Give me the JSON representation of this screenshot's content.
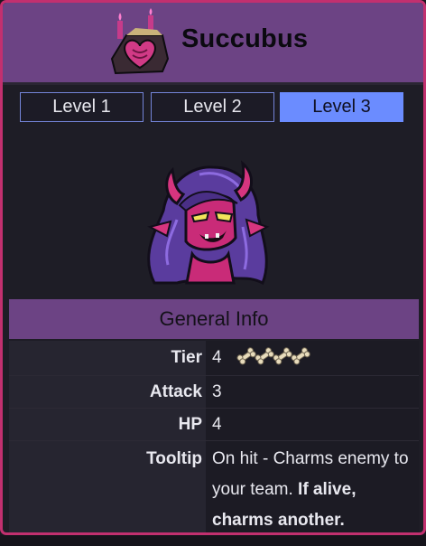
{
  "header": {
    "title": "Succubus",
    "icon": "succubus-emblem-icon"
  },
  "tabs": [
    {
      "label": "Level 1",
      "active": false
    },
    {
      "label": "Level 2",
      "active": false
    },
    {
      "label": "Level 3",
      "active": true
    }
  ],
  "portrait": {
    "icon": "succubus-portrait"
  },
  "section": {
    "title": "General Info"
  },
  "info": {
    "tier": {
      "label": "Tier",
      "value": "4",
      "icon": "bone-icon",
      "icon_count": 4
    },
    "attack": {
      "label": "Attack",
      "value": "3"
    },
    "hp": {
      "label": "HP",
      "value": "4"
    },
    "tooltip": {
      "label": "Tooltip",
      "text_plain": "On hit - Charms enemy to your team.",
      "text_bold": "If alive, charms another."
    }
  },
  "colors": {
    "border": "#c2306f",
    "header_bg": "#6c4384",
    "active_tab": "#6b8cff",
    "tab_border": "#7485d9"
  }
}
